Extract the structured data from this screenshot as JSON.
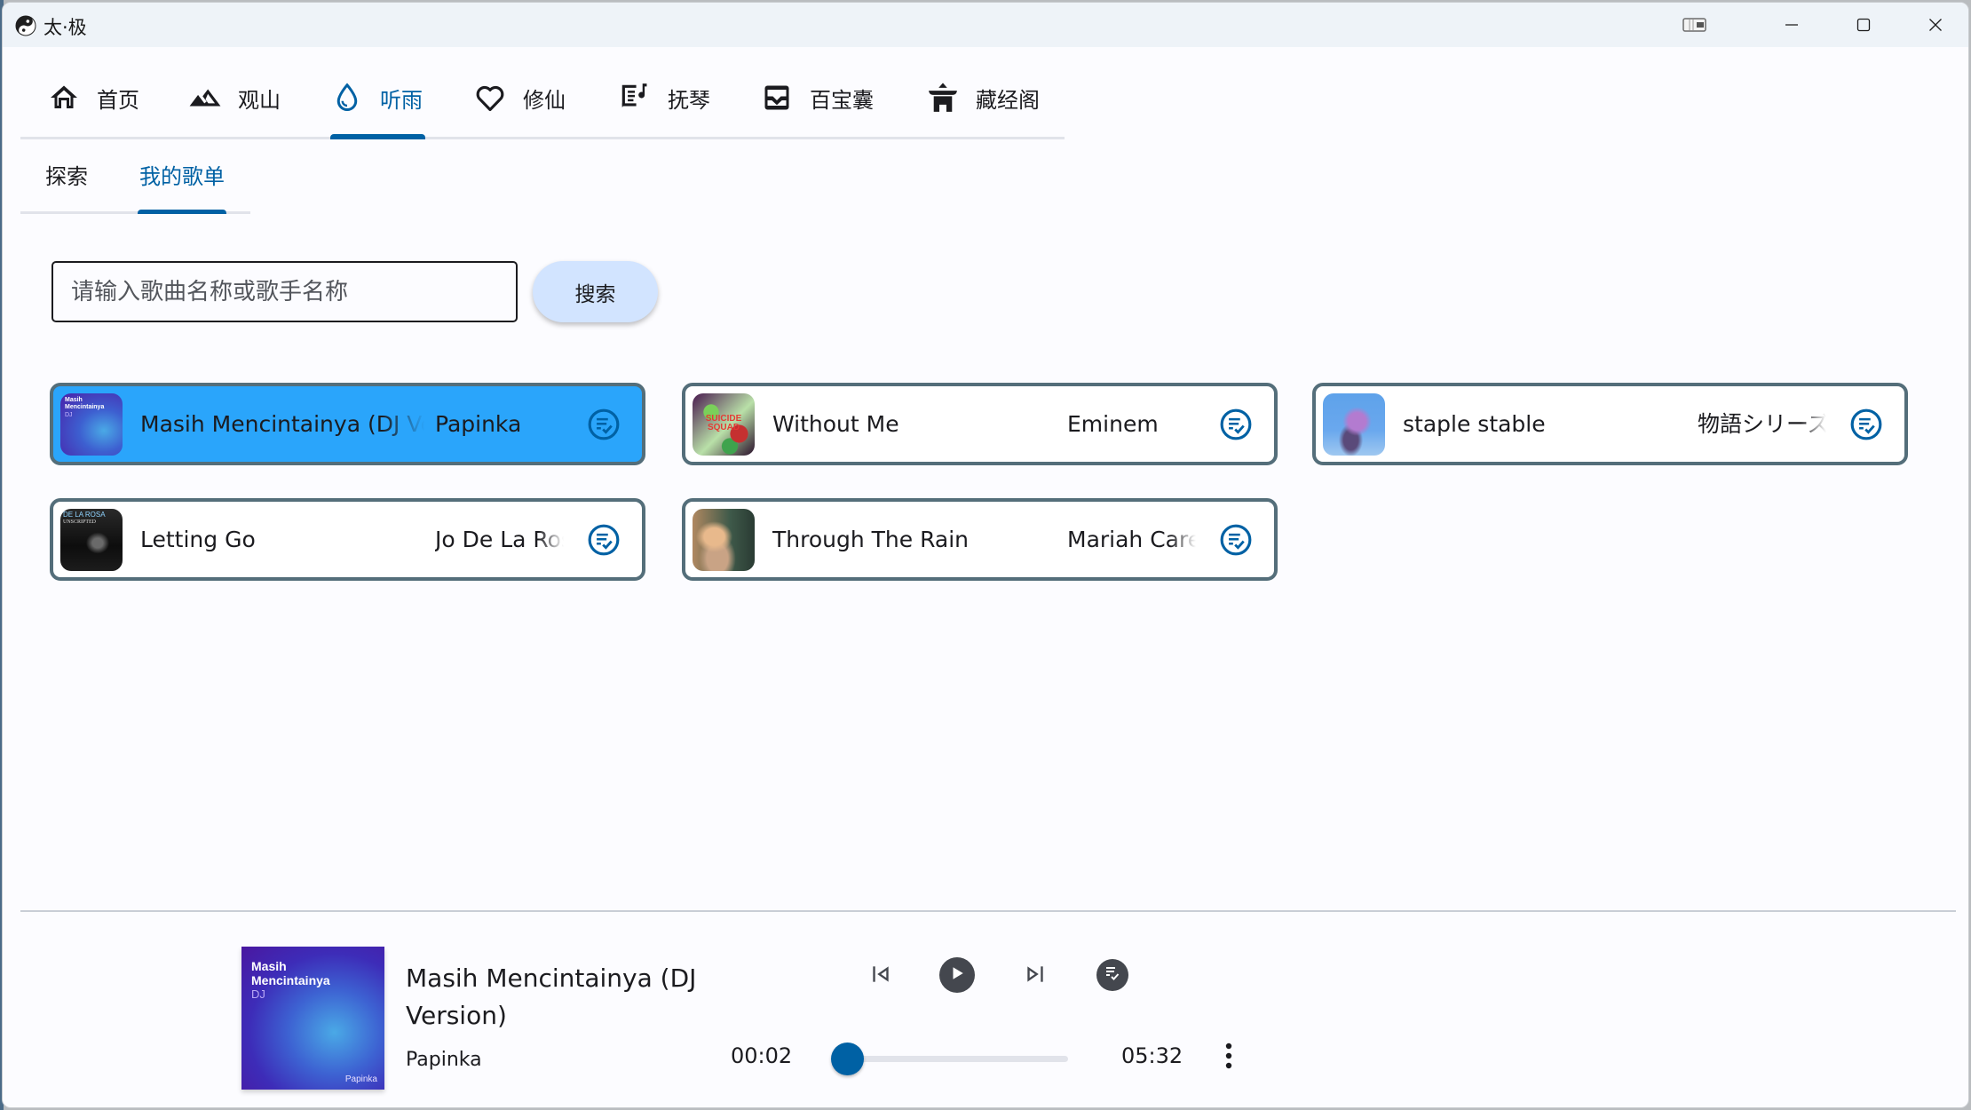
{
  "window": {
    "title": "太·极",
    "controls": [
      "snap-layout",
      "minimize",
      "maximize",
      "close"
    ]
  },
  "nav": {
    "active_index": 2,
    "tabs": [
      {
        "label": "首页",
        "icon": "home-icon"
      },
      {
        "label": "观山",
        "icon": "mountain-icon"
      },
      {
        "label": "听雨",
        "icon": "water-drop-icon"
      },
      {
        "label": "修仙",
        "icon": "heart-icon"
      },
      {
        "label": "抚琴",
        "icon": "lyrics-icon"
      },
      {
        "label": "百宝囊",
        "icon": "inbox-tray-icon"
      },
      {
        "label": "藏经阁",
        "icon": "temple-icon"
      }
    ]
  },
  "subnav": {
    "active_index": 1,
    "tabs": [
      {
        "label": "探索"
      },
      {
        "label": "我的歌单"
      }
    ]
  },
  "search": {
    "placeholder": "请输入歌曲名称或歌手名称",
    "value": "",
    "button_label": "搜索"
  },
  "songs": [
    {
      "title": "Masih Mencintainya (DJ Version)",
      "artist": "Papinka",
      "selected": true,
      "cover": "Masih Mencintainya DJ"
    },
    {
      "title": "Without Me",
      "artist": "Eminem",
      "selected": false,
      "cover": "Suicide Squad"
    },
    {
      "title": "staple stable",
      "artist": "物語シリーズ",
      "selected": false,
      "cover": "anime"
    },
    {
      "title": "Letting Go",
      "artist": "Jo De La Rosa",
      "selected": false,
      "cover": "Jo De La Rosa Unscripted"
    },
    {
      "title": "Through The Rain",
      "artist": "Mariah Carey",
      "selected": false,
      "cover": "Mariah Carey"
    }
  ],
  "player": {
    "title": "Masih Mencintainya (DJ Version)",
    "artist": "Papinka",
    "cover_text": {
      "line1": "Masih",
      "line2": "Mencintainya",
      "line3": "DJ",
      "credit": "Papinka"
    },
    "elapsed": "00:02",
    "duration": "05:32",
    "progress_fraction": 0.006,
    "state": "paused"
  },
  "colors": {
    "accent": "#0061a4",
    "selected_card": "#2aa5fb",
    "card_border": "#546e7a",
    "search_button": "#d2e4ff",
    "titlebar": "#eef3f8",
    "player_button": "#44474e"
  }
}
